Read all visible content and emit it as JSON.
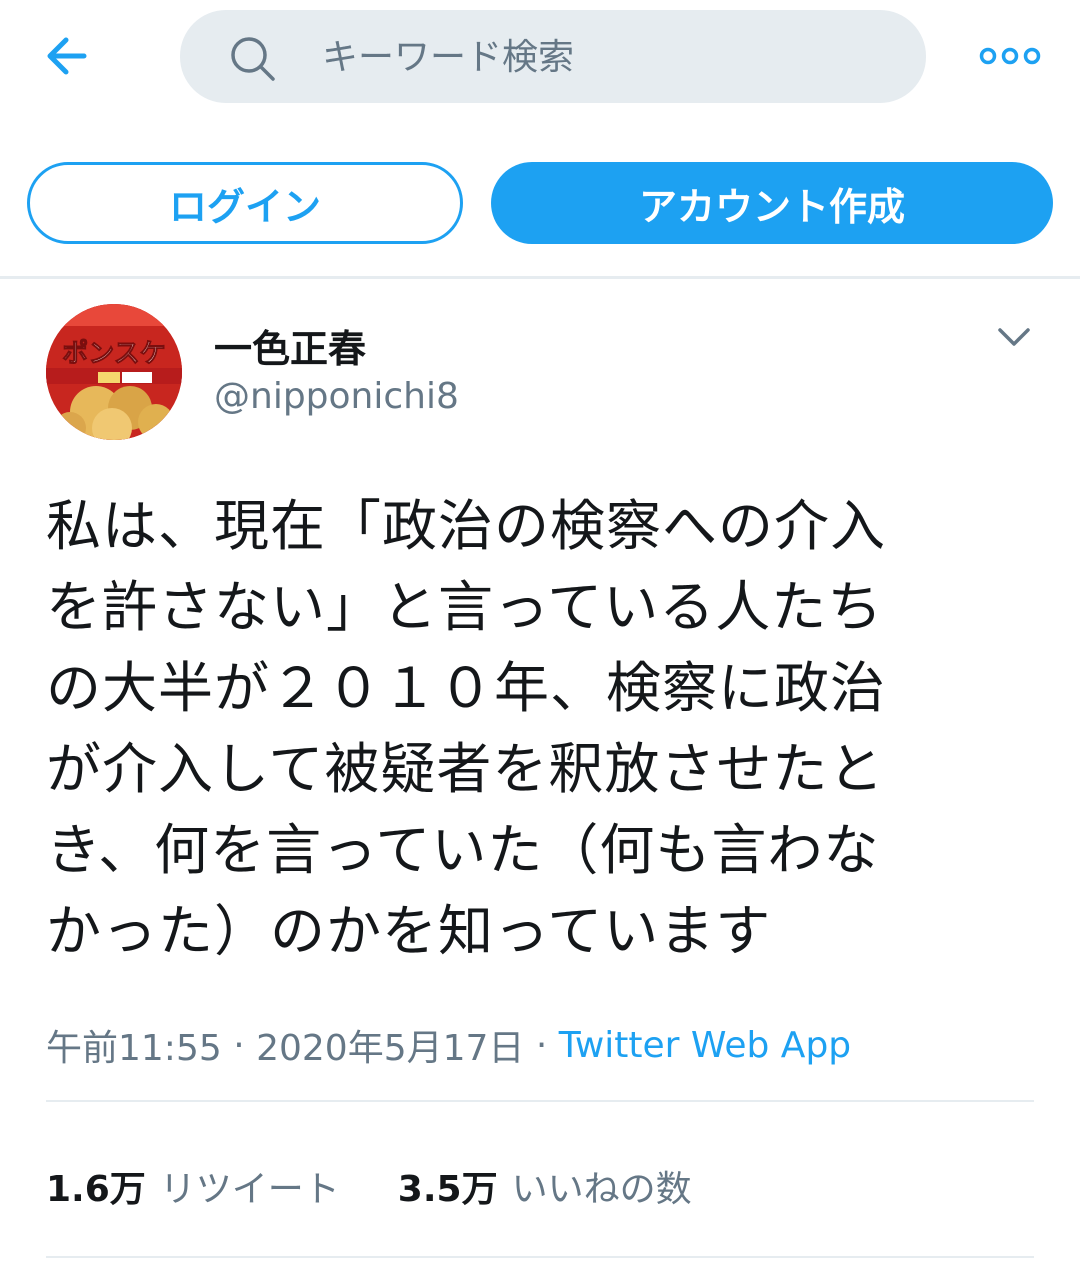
{
  "colors": {
    "accent": "#1da1f2",
    "text": "#14171a",
    "muted": "#657786",
    "search_bg": "#e6ecf0"
  },
  "header": {
    "back_icon": "arrow-left-icon",
    "search_icon": "search-icon",
    "search_placeholder": "キーワード検索",
    "more_icon": "more-horizontal-icon"
  },
  "auth": {
    "login_label": "ログイン",
    "signup_label": "アカウント作成"
  },
  "tweet": {
    "author_name": "一色正春",
    "author_handle": "@nipponichi8",
    "avatar_text": "ポンスケ",
    "text": "私は、現在「政治の検察への介入\nを許さない」と言っている人たち\nの大半が２０１０年、検察に政治\nが介入して被疑者を釈放させたと\nき、何を言っていた（何も言わな\nかった）のかを知っています",
    "time": "午前11:55",
    "dot1": " · ",
    "date": "2020年5月17日",
    "dot2": " · ",
    "source": "Twitter Web App",
    "retweets_count": "1.6万",
    "retweets_label": "リツイート",
    "likes_count": "3.5万",
    "likes_label": "いいねの数"
  }
}
